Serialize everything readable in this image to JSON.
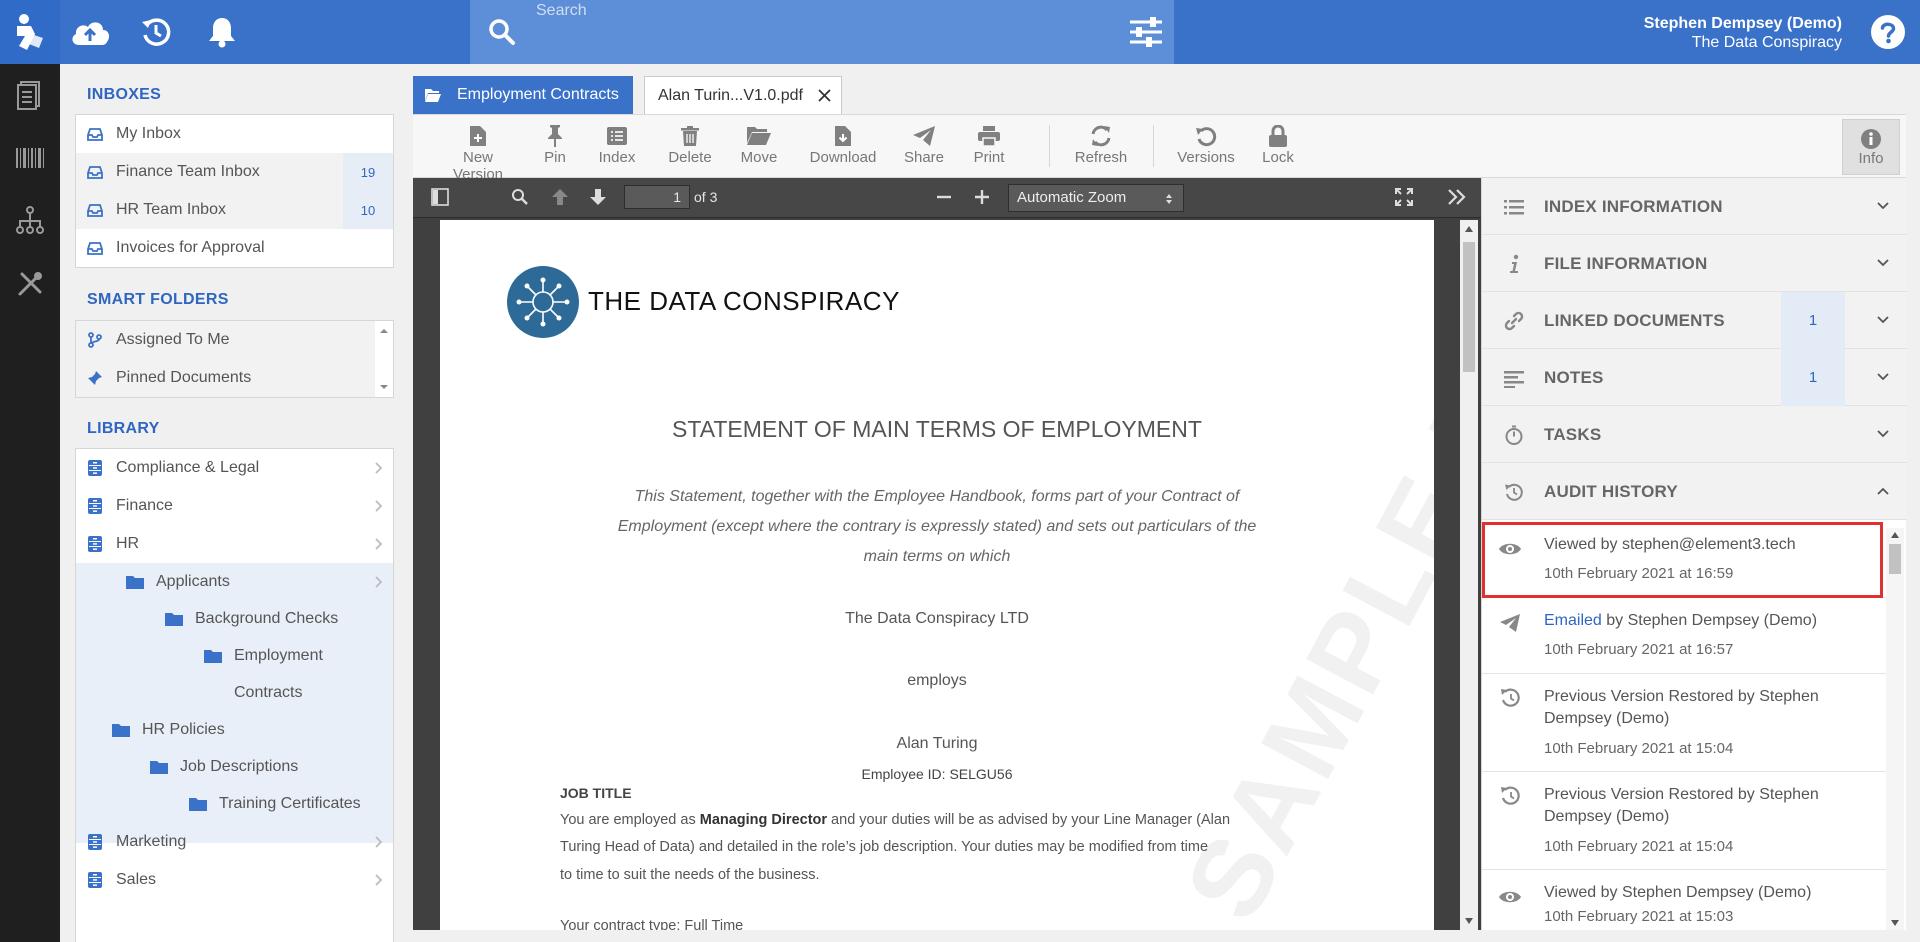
{
  "topbar": {
    "search_placeholder": "Search",
    "user_name": "Stephen Dempsey (Demo)",
    "org_name": "The Data Conspiracy"
  },
  "sidebar": {
    "inboxes_title": "INBOXES",
    "inboxes": [
      {
        "label": "My Inbox",
        "count": ""
      },
      {
        "label": "Finance Team Inbox",
        "count": "19"
      },
      {
        "label": "HR Team Inbox",
        "count": "10"
      },
      {
        "label": "Invoices for Approval",
        "count": ""
      }
    ],
    "smart_title": "SMART FOLDERS",
    "smart": [
      {
        "label": "Assigned To Me"
      },
      {
        "label": "Pinned Documents"
      }
    ],
    "library_title": "LIBRARY",
    "library": [
      {
        "label": "Compliance & Legal"
      },
      {
        "label": "Finance"
      },
      {
        "label": "HR"
      },
      {
        "label": "Applicants"
      },
      {
        "label": "Background Checks"
      },
      {
        "label": "Employment"
      },
      {
        "label": "Contracts"
      },
      {
        "label": "HR Policies"
      },
      {
        "label": "Job Descriptions"
      },
      {
        "label": "Training Certificates"
      },
      {
        "label": "Marketing"
      },
      {
        "label": "Sales"
      }
    ]
  },
  "tabs": {
    "folder_tab": "Employment Contracts",
    "doc_tab": "Alan Turin...V1.0.pdf"
  },
  "toolbar": {
    "new_version": "New Version",
    "pin": "Pin",
    "index": "Index",
    "delete": "Delete",
    "move": "Move",
    "download": "Download",
    "share": "Share",
    "print": "Print",
    "refresh": "Refresh",
    "versions": "Versions",
    "lock": "Lock",
    "info": "Info"
  },
  "viewer": {
    "page_current": "1",
    "page_of": "of 3",
    "zoom": "Automatic Zoom"
  },
  "document": {
    "company_logo_text": "THE DATA CONSPIRACY",
    "heading": "STATEMENT OF MAIN TERMS OF EMPLOYMENT",
    "intro_line1": "This Statement, together with the Employee Handbook, forms part of your Contract of",
    "intro_line2": "Employment (except where the contrary is expressly stated) and sets out particulars of the",
    "intro_line3": "main terms on which",
    "employer": "The Data Conspiracy LTD",
    "employs": "employs",
    "employee": "Alan Turing",
    "employee_id": "Employee ID: SELGU56",
    "job_title_label": "JOB TITLE",
    "body_pre": "You are employed as ",
    "body_bold": "Managing Director",
    "body_post": " and your duties will be as advised by your Line Manager (Alan",
    "body_line2": "Turing Head of Data) and detailed in the role’s job description. Your duties may be modified from time",
    "body_line3": "to time to suit the needs of the business.",
    "contract_type": "Your contract type: Full Time",
    "watermark": "SAMPLE DATA"
  },
  "panel": {
    "sections": [
      {
        "title": "INDEX INFORMATION",
        "badge": ""
      },
      {
        "title": "FILE INFORMATION",
        "badge": ""
      },
      {
        "title": "LINKED DOCUMENTS",
        "badge": "1"
      },
      {
        "title": "NOTES",
        "badge": "1"
      },
      {
        "title": "TASKS",
        "badge": ""
      },
      {
        "title": "AUDIT HISTORY",
        "badge": ""
      }
    ],
    "audit": [
      {
        "prefix": "",
        "text": "Viewed by stephen@element3.tech",
        "time": "10th February 2021 at 16:59"
      },
      {
        "prefix": "Emailed",
        "text": " by Stephen Dempsey (Demo)",
        "time": "10th February 2021 at 16:57"
      },
      {
        "prefix": "",
        "text": "Previous Version Restored by Stephen Dempsey (Demo)",
        "time": "10th February 2021 at 15:04"
      },
      {
        "prefix": "",
        "text": "Previous Version Restored by Stephen Dempsey (Demo)",
        "time": "10th February 2021 at 15:04"
      },
      {
        "prefix": "",
        "text": "Viewed by Stephen Dempsey (Demo)",
        "time": "10th February 2021 at 15:03"
      }
    ]
  },
  "colors": {
    "brand_blue": "#3a72c9",
    "highlight_red": "#e03131"
  }
}
